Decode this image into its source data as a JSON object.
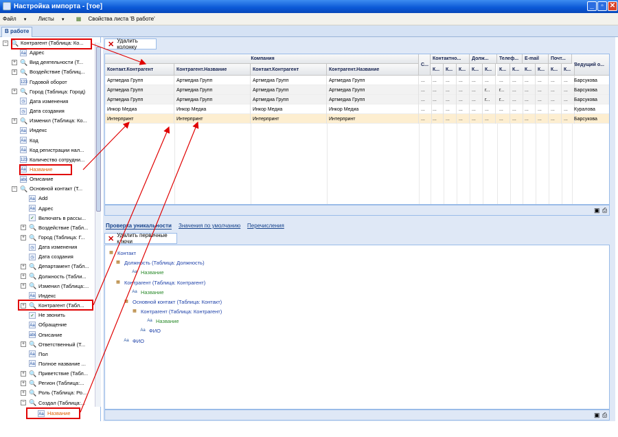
{
  "window": {
    "title": "Настройка импорта - [тое]"
  },
  "menu": {
    "file": "Файл",
    "sheets": "Листы",
    "sheet_props": "Свойства листа 'В работе'"
  },
  "tabs": {
    "work": "В работе"
  },
  "left_tree": [
    {
      "label": "Контрагент (Таблица: Ко...",
      "icon": "search-icon"
    },
    {
      "label": "Адрес",
      "icon": "text-field-icon"
    },
    {
      "label": "Вид деятельности (Т...",
      "icon": "search-icon"
    },
    {
      "label": "Воздействие (Таблиц...",
      "icon": "search-icon"
    },
    {
      "label": "Годовой оборот",
      "icon": "number-field-icon"
    },
    {
      "label": "Город (Таблица: Город)",
      "icon": "search-icon"
    },
    {
      "label": "Дата изменения",
      "icon": "date-field-icon"
    },
    {
      "label": "Дата создания",
      "icon": "date-field-icon"
    },
    {
      "label": "Изменил (Таблица: Ко...",
      "icon": "search-icon"
    },
    {
      "label": "Индекс",
      "icon": "text-field-icon"
    },
    {
      "label": "Код",
      "icon": "text-field-icon"
    },
    {
      "label": "Код регистрации нал...",
      "icon": "text-field-icon"
    },
    {
      "label": "Количество сотрудни...",
      "icon": "number-field-icon"
    },
    {
      "label": "Название",
      "icon": "text-field-icon"
    },
    {
      "label": "Описание",
      "icon": "memo-field-icon"
    },
    {
      "label": "Основной контакт (Т...",
      "icon": "search-icon"
    },
    {
      "label": "Add",
      "icon": "text-field-icon"
    },
    {
      "label": "Адрес",
      "icon": "text-field-icon"
    },
    {
      "label": "Включать в рассы...",
      "icon": "checkbox-field-icon"
    },
    {
      "label": "Воздействие (Табл...",
      "icon": "search-icon"
    },
    {
      "label": "Город (Таблица: Г...",
      "icon": "search-icon"
    },
    {
      "label": "Дата изменения",
      "icon": "date-field-icon"
    },
    {
      "label": "Дата создания",
      "icon": "date-field-icon"
    },
    {
      "label": "Департамент (Табл...",
      "icon": "search-icon"
    },
    {
      "label": "Должность (Табли...",
      "icon": "search-icon"
    },
    {
      "label": "Изменил (Таблица:...",
      "icon": "search-icon"
    },
    {
      "label": "Индекс",
      "icon": "text-field-icon"
    },
    {
      "label": "Контрагент (Табл...",
      "icon": "search-icon"
    },
    {
      "label": "Не звонить",
      "icon": "checkbox-field-icon"
    },
    {
      "label": "Обращение",
      "icon": "text-field-icon"
    },
    {
      "label": "Описание",
      "icon": "memo-field-icon"
    },
    {
      "label": "Ответственный (Т...",
      "icon": "search-icon"
    },
    {
      "label": "Пол",
      "icon": "text-field-icon"
    },
    {
      "label": "Полное название ...",
      "icon": "text-field-icon"
    },
    {
      "label": "Приветствие (Табл...",
      "icon": "search-icon"
    },
    {
      "label": "Регион (Таблица:...",
      "icon": "search-icon"
    },
    {
      "label": "Роль (Таблица: Ро...",
      "icon": "search-icon"
    },
    {
      "label": "Создал (Таблица:...",
      "icon": "search-icon"
    },
    {
      "label": "Название",
      "icon": "text-field-icon"
    }
  ],
  "toolbar": {
    "delete_column": "Удалить колонку",
    "delete_keys": "Удалить первичные ключи"
  },
  "grid": {
    "group_headers": [
      "Компания",
      "С...",
      "Контактно...",
      "Долж...",
      "Телеф...",
      "E-mail",
      "Почт...",
      "Ведущий о..."
    ],
    "columns": [
      "Контакт.Контрагент",
      "Контрагент.Название",
      "Контакт.Контрагент",
      "Контрагент.Название"
    ],
    "sub_short": "К...",
    "rows": [
      {
        "c1": "Артмедиа Групп",
        "c2": "Артмедиа Групп",
        "c3": "Артмедиа Групп",
        "c4": "Артмедиа Групп",
        "cols": [
          "...",
          "...",
          "...",
          "...",
          "...",
          "...",
          "...",
          "...",
          "...",
          "...",
          "...",
          "..."
        ],
        "owner": "Барсукова"
      },
      {
        "c1": "Артмедиа Групп",
        "c2": "Артмедиа Групп",
        "c3": "Артмедиа Групп",
        "c4": "Артмедиа Групп",
        "cols": [
          "...",
          "...",
          "...",
          "...",
          "...",
          "г...",
          "г...",
          "...",
          "...",
          "...",
          "...",
          "..."
        ],
        "owner": "Барсукова"
      },
      {
        "c1": "Артмедиа Групп",
        "c2": "Артмедиа Групп",
        "c3": "Артмедиа Групп",
        "c4": "Артмедиа Групп",
        "cols": [
          "...",
          "...",
          "...",
          "...",
          "...",
          "г...",
          "г...",
          "...",
          "...",
          "...",
          "...",
          "..."
        ],
        "owner": "Барсукова"
      },
      {
        "c1": "Инкор Медиа",
        "c2": "Инкор Медиа",
        "c3": "Инкор Медиа",
        "c4": "Инкор Медиа",
        "cols": [
          "...",
          "...",
          "...",
          "...",
          "...",
          "...",
          "...",
          "...",
          "...",
          "...",
          "...",
          "..."
        ],
        "owner": "Куралова"
      },
      {
        "c1": "Интерпринт",
        "c2": "Интерпринт",
        "c3": "Интерпринт",
        "c4": "Интерпринт",
        "cols": [
          "...",
          "...",
          "...",
          "...",
          "...",
          "...",
          "...",
          "...",
          "...",
          "...",
          "...",
          "..."
        ],
        "owner": "Барсукова"
      }
    ]
  },
  "subtabs": {
    "uniqueness": "Проверка уникальности",
    "defaults": "Значения по умолчанию",
    "enums": "Перечисления"
  },
  "key_tree": {
    "contact": "Контакт",
    "position": "Должность (Таблица: Должность)",
    "name1": "Название",
    "counterparty": "Контрагент (Таблица: Контрагент)",
    "name2": "Название",
    "main_contact": "Основной контакт (Таблица: Контакт)",
    "counterparty2": "Контрагент (Таблица: Контрагент)",
    "name3": "Название",
    "fio_inner": "ФИО",
    "fio": "ФИО"
  },
  "colors": {
    "title_bar": "#0a58d6",
    "accent_red": "#e00000",
    "panel_border": "#99bbe8",
    "highlight_row": "#fdeed0"
  }
}
